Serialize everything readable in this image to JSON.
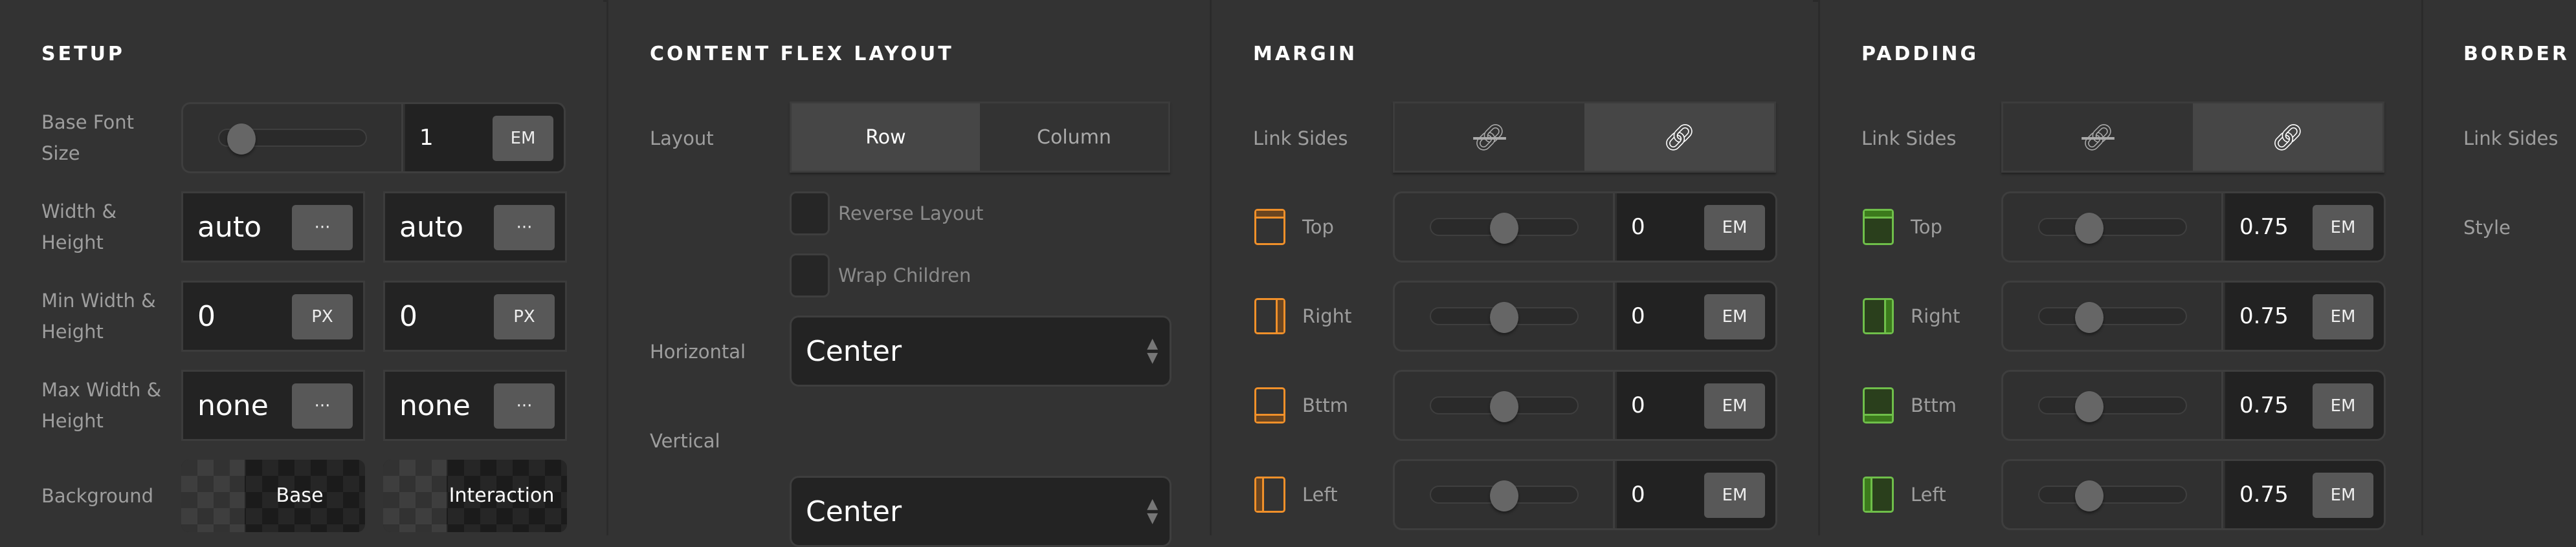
{
  "colors": {
    "margin_accent": "#f0902a",
    "margin_fill": "#6a4520",
    "padding_accent": "#6fbf4a",
    "padding_fill": "#2a3f1c"
  },
  "setup": {
    "title": "SETUP",
    "base_font_size": {
      "label": "Base Font Size",
      "value": "1",
      "unit": "EM",
      "slider_fraction": 0.15
    },
    "width_height": {
      "label": "Width & Height",
      "width": "auto",
      "height": "auto",
      "menu": "···"
    },
    "min_width_height": {
      "label": "Min Width & Height",
      "width": "0",
      "height": "0",
      "unit": "PX"
    },
    "max_width_height": {
      "label": "Max Width & Height",
      "width": "none",
      "height": "none",
      "menu": "···"
    },
    "background": {
      "label": "Background",
      "base": "Base",
      "interaction": "Interaction"
    }
  },
  "flex": {
    "title": "CONTENT FLEX LAYOUT",
    "layout_label": "Layout",
    "options": [
      "Row",
      "Column"
    ],
    "selected": "Row",
    "reverse": {
      "label": "Reverse Layout",
      "checked": false
    },
    "wrap": {
      "label": "Wrap Children",
      "checked": false
    },
    "horizontal": {
      "label": "Horizontal",
      "value": "Center"
    },
    "vertical": {
      "label": "Vertical",
      "value": "Center"
    }
  },
  "margin": {
    "title": "MARGIN",
    "link_label": "Link Sides",
    "link_state": "linked",
    "sides": [
      {
        "label": "Top",
        "value": "0",
        "unit": "EM",
        "slider_fraction": 0.5
      },
      {
        "label": "Right",
        "value": "0",
        "unit": "EM",
        "slider_fraction": 0.5
      },
      {
        "label": "Bttm",
        "value": "0",
        "unit": "EM",
        "slider_fraction": 0.5
      },
      {
        "label": "Left",
        "value": "0",
        "unit": "EM",
        "slider_fraction": 0.5
      }
    ]
  },
  "padding": {
    "title": "PADDING",
    "link_label": "Link Sides",
    "link_state": "linked",
    "sides": [
      {
        "label": "Top",
        "value": "0.75",
        "unit": "EM",
        "slider_fraction": 0.34
      },
      {
        "label": "Right",
        "value": "0.75",
        "unit": "EM",
        "slider_fraction": 0.34
      },
      {
        "label": "Bttm",
        "value": "0.75",
        "unit": "EM",
        "slider_fraction": 0.34
      },
      {
        "label": "Left",
        "value": "0.75",
        "unit": "EM",
        "slider_fraction": 0.34
      }
    ]
  },
  "border": {
    "title": "BORDER",
    "link_label": "Link Sides",
    "style_label": "Style"
  }
}
